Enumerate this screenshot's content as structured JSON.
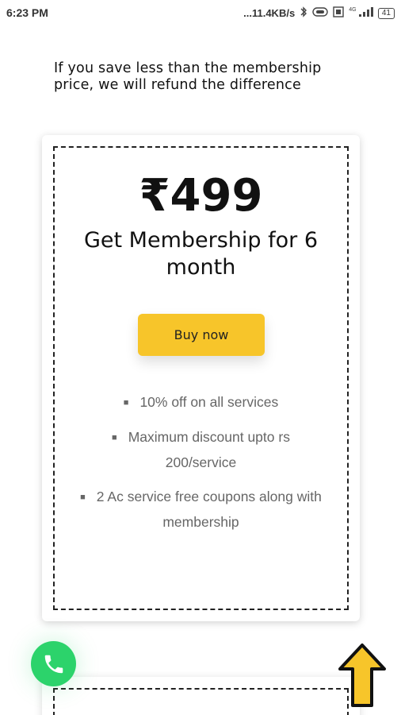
{
  "status_bar": {
    "time": "6:23 PM",
    "network_speed": "...11.4KB/s",
    "network_label": "4G",
    "battery": "41",
    "icons": [
      "bluetooth-icon",
      "volte-icon",
      "data-icon",
      "signal-icon",
      "battery-icon"
    ]
  },
  "intro": {
    "text": "If you save less than the membership price, we will refund the difference"
  },
  "plan": {
    "price": "₹499",
    "title": "Get Membership for 6 month",
    "buy_label": "Buy now",
    "features": [
      "10% off on all services",
      "Maximum discount upto rs 200/service",
      "2 Ac service free coupons along with membership"
    ]
  },
  "colors": {
    "buy_button": "#f7c52a",
    "call_button": "#2cd36b",
    "arrow": "#f7c52a"
  },
  "floating": {
    "call_icon": "phone-icon",
    "scroll_icon": "arrow-up-icon"
  }
}
